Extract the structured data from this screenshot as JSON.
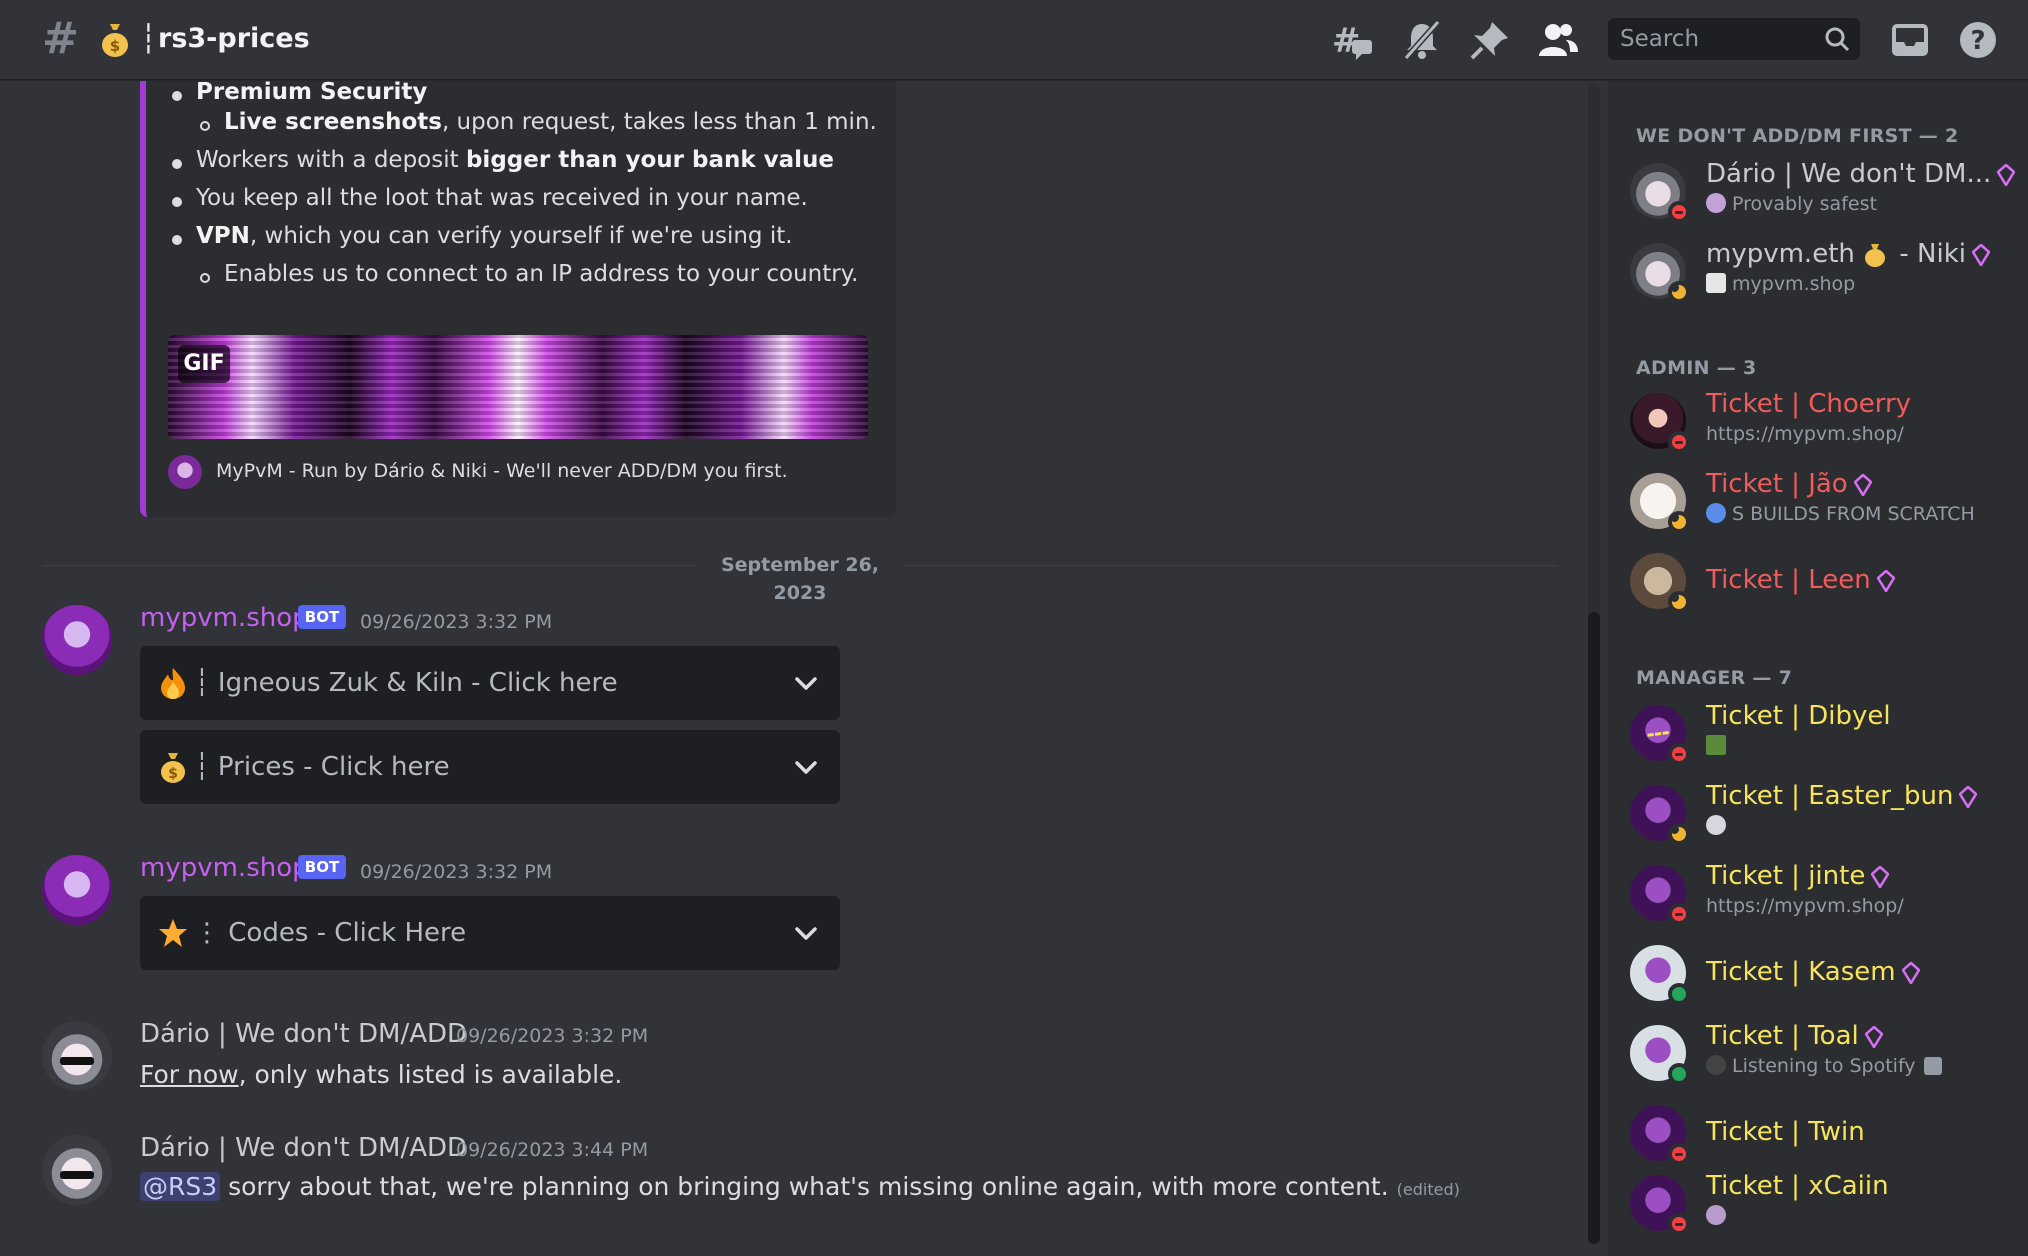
{
  "header": {
    "channel_emoji": "money-bag",
    "channel_separator": "┆",
    "channel_name": "rs3-prices",
    "search_placeholder": "Search"
  },
  "embed": {
    "lines": [
      {
        "bold": "Premium Security",
        "text": ""
      },
      {
        "bold": "Live screenshots",
        "text": ", upon request, takes less than 1 min."
      },
      {
        "pre": "Workers with a deposit ",
        "bold": "bigger than your bank value"
      },
      {
        "text": "You keep all the loot that was received in your name."
      },
      {
        "bold": "VPN",
        "text": ", which you can verify yourself if we're using it."
      },
      {
        "text": "Enables us to connect to an IP address to your country."
      }
    ],
    "gif_label": "GIF",
    "footer": "MyPvM - Run by Dário & Niki - We'll never ADD/DM you first."
  },
  "divider": "September 26, 2023",
  "messages": [
    {
      "author": "mypvm.shop",
      "badge": "BOT",
      "timestamp": "09/26/2023 3:32 PM",
      "selects": [
        {
          "emoji": "fire",
          "label": "┆ Igneous Zuk & Kiln - Click here"
        },
        {
          "emoji": "money-bag",
          "label": "┆ Prices - Click here"
        }
      ]
    },
    {
      "author": "mypvm.shop",
      "badge": "BOT",
      "timestamp": "09/26/2023 3:32 PM",
      "selects": [
        {
          "emoji": "star",
          "label": "⋮ Codes - Click Here"
        }
      ]
    },
    {
      "author": "Dário | We don't DM/ADD",
      "timestamp": "09/26/2023 3:32 PM",
      "link": "For now",
      "text": ", only whats listed is available."
    },
    {
      "author": "Dário | We don't DM/ADD",
      "timestamp": "09/26/2023 3:44 PM",
      "mention": "@RS3",
      "text": " sorry about that, we're planning on bringing what's missing online again, with more content.",
      "edited": "(edited)"
    }
  ],
  "members": {
    "groups": [
      {
        "title": "WE DON'T ADD/DM FIRST — 2",
        "items": [
          {
            "name": "Dário | We don't DM...",
            "sub": "Provably safest",
            "status": "dnd"
          },
          {
            "name_pre": "mypvm.eth ",
            "name_post": " - Niki",
            "sub": "mypvm.shop",
            "status": "idle"
          }
        ]
      },
      {
        "title": "ADMIN — 3",
        "items": [
          {
            "name": "Ticket | Choerry",
            "sub": "https://mypvm.shop/",
            "status": "dnd"
          },
          {
            "name": "Ticket | Jão",
            "sub": "S BUILDS FROM SCRATCH",
            "status": "idle"
          },
          {
            "name": "Ticket | Leen",
            "status": "idle"
          }
        ]
      },
      {
        "title": "MANAGER — 7",
        "items": [
          {
            "name": "Ticket | Dibyel",
            "status": "dnd"
          },
          {
            "name": "Ticket | Easter_bun",
            "status": "idle"
          },
          {
            "name": "Ticket | jinte",
            "sub": "https://mypvm.shop/",
            "status": "dnd"
          },
          {
            "name": "Ticket | Kasem",
            "status": "online"
          },
          {
            "name": "Ticket | Toal",
            "sub": "Listening to Spotify",
            "status": "online"
          },
          {
            "name": "Ticket | Twin",
            "status": "dnd"
          },
          {
            "name": "Ticket | xCaiin",
            "status": "dnd"
          }
        ]
      }
    ]
  },
  "colors": {
    "bot_name": "#c561f0",
    "admin_name": "#f05b5b",
    "manager_name": "#f8e45c",
    "embed_border": "#a03bd3",
    "bot_badge": "#5865f2"
  }
}
